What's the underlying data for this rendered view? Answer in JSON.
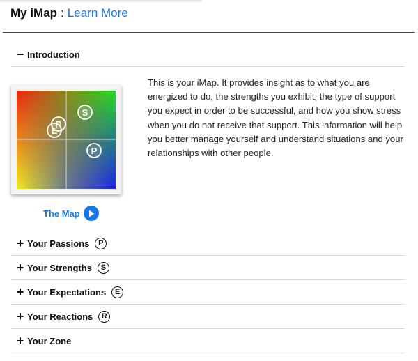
{
  "header": {
    "title": "My iMap",
    "separator": ":",
    "link": "Learn More"
  },
  "sections": [
    {
      "label": "Introduction",
      "symbol": "−",
      "expanded": true,
      "badge": ""
    },
    {
      "label": "Your Passions",
      "symbol": "+",
      "expanded": false,
      "badge": "P"
    },
    {
      "label": "Your Strengths",
      "symbol": "+",
      "expanded": false,
      "badge": "S"
    },
    {
      "label": "Your Expectations",
      "symbol": "+",
      "expanded": false,
      "badge": "E"
    },
    {
      "label": "Your Reactions",
      "symbol": "+",
      "expanded": false,
      "badge": "R"
    },
    {
      "label": "Your Zone",
      "symbol": "+",
      "expanded": false,
      "badge": ""
    }
  ],
  "intro": {
    "text": "This is your iMap. It provides insight as to what you are energized to do, the strengths you exhibit, the type of support you expect in order to be successful, and how you show stress when you do not receive that support. This information will help you better manage yourself and understand situations and your relationships with other people.",
    "map_caption": "The Map",
    "map_markers": {
      "s": "S",
      "p": "P",
      "e": "E",
      "r": "R"
    }
  },
  "colors": {
    "link": "#1877e6",
    "divider": "#d8d8d8",
    "map_red": "#ee2211",
    "map_green": "#22dd22",
    "map_yellow": "#f2ec22",
    "map_blue": "#1a22ee"
  },
  "icons": {
    "expand": "plus-icon",
    "collapse": "minus-icon",
    "play": "play-icon"
  }
}
